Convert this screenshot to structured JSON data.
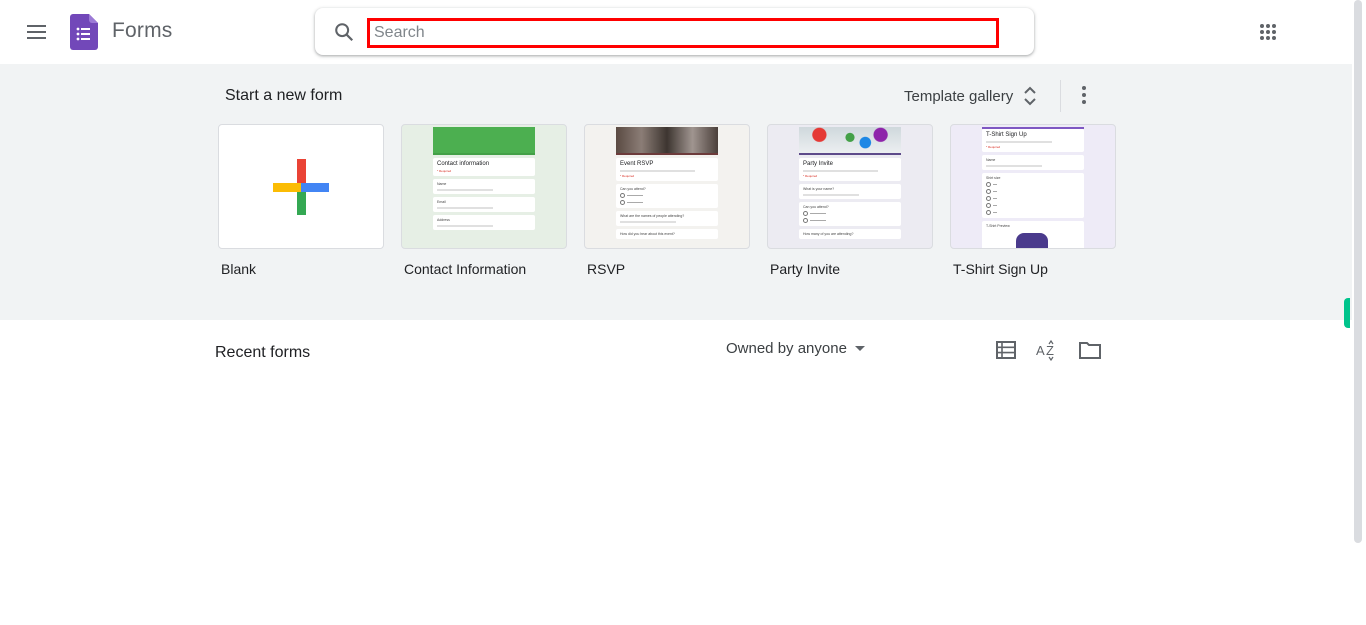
{
  "header": {
    "app_name": "Forms",
    "search": {
      "placeholder": "Search",
      "value": ""
    },
    "icons": {
      "menu": "hamburger-menu-icon",
      "logo": "google-forms-logo",
      "search": "search-icon",
      "apps": "google-apps-grid-icon"
    }
  },
  "templates": {
    "section_title": "Start a new form",
    "gallery_label": "Template gallery",
    "gallery_icon": "unfold-more-icon",
    "more_icon": "more-vertical-icon",
    "items": [
      {
        "label": "Blank",
        "thumb": "plus-icon"
      },
      {
        "label": "Contact Information",
        "thumb_title": "Contact information",
        "accent": "#43a047",
        "bg": "#e6efe5",
        "fields": [
          "Name",
          "Email",
          "Address"
        ]
      },
      {
        "label": "RSVP",
        "thumb_title": "Event RSVP",
        "accent": "#6d3b3b",
        "bg": "#f3f2ef",
        "fields": [
          "Can you attend?",
          "What are the names of people attending?",
          "How did you hear about this event?"
        ]
      },
      {
        "label": "Party Invite",
        "thumb_title": "Party Invite",
        "accent": "#5e4b8b",
        "bg": "#ecebf2",
        "fields": [
          "What is your name?",
          "Can you attend?",
          "How many of you are attending?"
        ]
      },
      {
        "label": "T-Shirt Sign Up",
        "thumb_title": "T-Shirt Sign Up",
        "accent": "#7e57c2",
        "bg": "#eeebf7",
        "fields": [
          "Name",
          "Shirt size",
          "T-Shirt Preview"
        ]
      }
    ]
  },
  "recent": {
    "section_title": "Recent forms",
    "owner_filter": "Owned by anyone",
    "icons": {
      "list_view": "list-view-icon",
      "sort": "sort-az-icon",
      "folder": "folder-icon"
    }
  }
}
